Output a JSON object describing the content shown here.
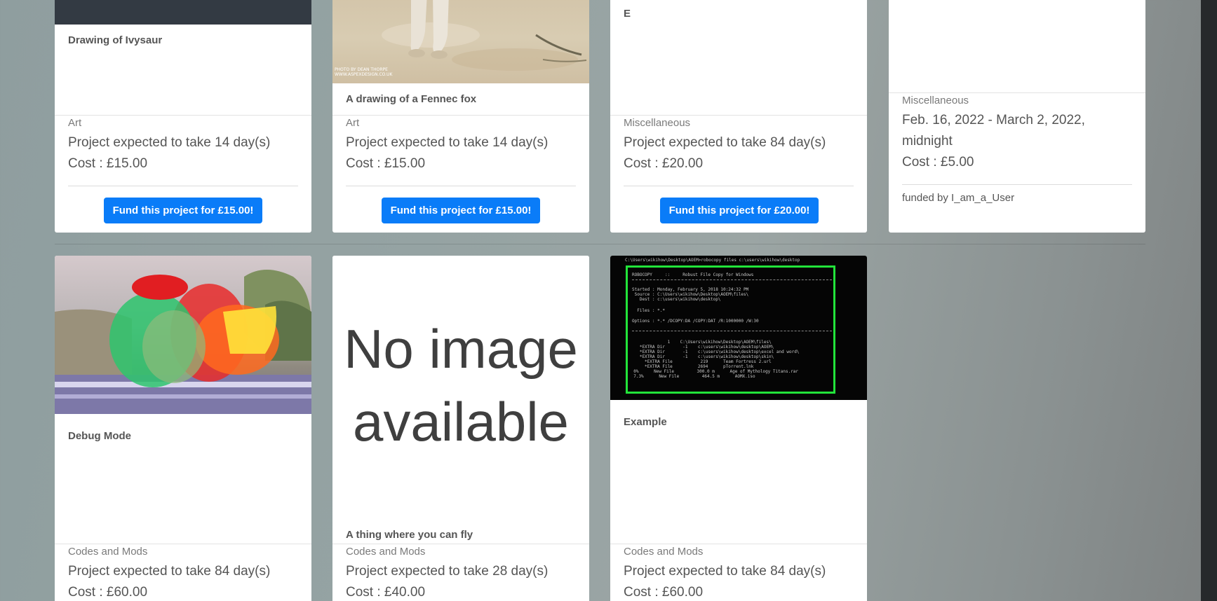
{
  "cards": [
    {
      "title": "Drawing of Ivysaur",
      "category": "Art",
      "duration": "Project expected to take 14 day(s)",
      "cost": "Cost : £15.00",
      "fund_label": "Fund this project for £15.00!"
    },
    {
      "title": "A drawing of a Fennec fox",
      "category": "Art",
      "duration": "Project expected to take 14 day(s)",
      "cost": "Cost : £15.00",
      "fund_label": "Fund this project for £15.00!",
      "image_credit_1": "PHOTO BY DEAN THORPE",
      "image_credit_2": "WWW.ASPEXDESIGN.CO.UK"
    },
    {
      "title": "E",
      "category": "Miscellaneous",
      "duration": "Project expected to take 84 day(s)",
      "cost": "Cost : £20.00",
      "fund_label": "Fund this project for £20.00!"
    },
    {
      "category": "Miscellaneous",
      "date_line_1": "Feb. 16, 2022 - March 2, 2022,",
      "date_line_2": "midnight",
      "cost": "Cost : £5.00",
      "funded_by": "funded by I_am_a_User"
    },
    {
      "title": "Debug Mode",
      "category": "Codes and Mods",
      "duration": "Project expected to take 84 day(s)",
      "cost": "Cost : £60.00"
    },
    {
      "title": "A thing where you can fly",
      "category": "Codes and Mods",
      "duration": "Project expected to take 28 day(s)",
      "cost": "Cost : £40.00",
      "placeholder_line_1": "No image",
      "placeholder_line_2": "available"
    },
    {
      "title": "Example",
      "category": "Codes and Mods",
      "duration": "Project expected to take 84 day(s)",
      "cost": "Cost : £60.00",
      "terminal": {
        "path_line": "C:\\Users\\wikihow\\Desktop\\AOEM>robocopy files c:\\users\\wikihow\\desktop",
        "header": "ROBOCOPY     ::     Robust File Copy for Windows",
        "started": "Started : Monday, February 5, 2018 10:24:32 PM",
        "source": " Source : C:\\Users\\wikihow\\Desktop\\AOEM\\files\\",
        "dest": "   Dest : c:\\users\\wikihow\\desktop\\",
        "files": "  Files : *.*",
        "options": "Options : *.* /DCOPY:DA /COPY:DAT /R:1000000 /W:30",
        "rows": [
          "              1    C:\\Users\\wikihow\\Desktop\\AOEM\\files\\",
          "   *EXTRA Dir       -1    c:\\users\\wikihow\\desktop\\AOEM\\",
          "   *EXTRA Dir       -1    c:\\users\\wikihow\\desktop\\excel and word\\",
          "   *EXTRA Dir       -1    c:\\users\\wikihow\\desktop\\skin\\",
          "     *EXTRA File           219      Team Fortress 2.url",
          "     *EXTRA File          2694      pTorrent.lnk",
          "  0%      New File         300.0 m      Age of Mythology Titans.rar",
          "  7.3%      New File         464.5 m      AOMX.iso"
        ]
      }
    }
  ],
  "colors": {
    "fund_button": "#0a7cf8",
    "terminal_border": "#22e43a"
  }
}
